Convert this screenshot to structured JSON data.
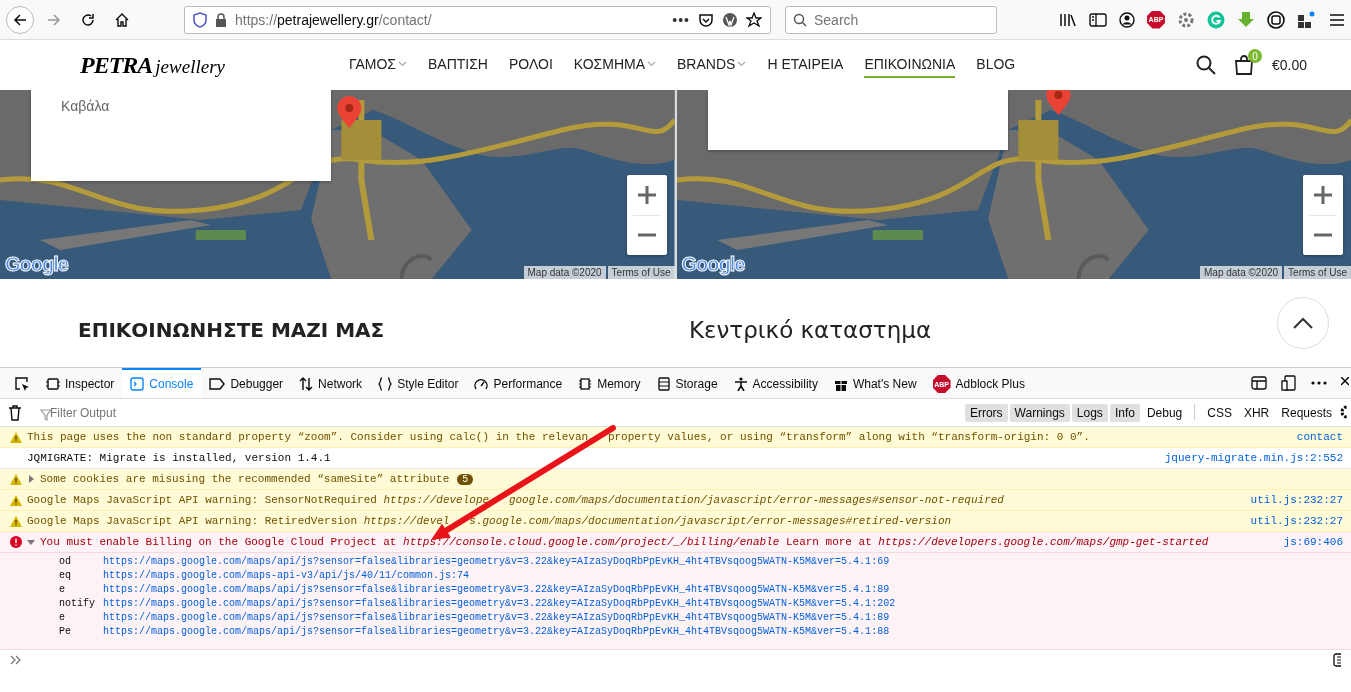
{
  "browser": {
    "url": {
      "scheme": "https://",
      "domain": "petrajewellery.gr",
      "path": "/contact/"
    },
    "page_actions": "•••",
    "search": {
      "placeholder": "Search"
    },
    "abp_label": "ABP"
  },
  "site": {
    "logo": {
      "main": "PETRA",
      "sub": "jewellery"
    },
    "nav": [
      {
        "label": "ΓΑΜΟΣ",
        "dropdown": true,
        "selected": false
      },
      {
        "label": "ΒΑΠΤΙΣΗ",
        "dropdown": false,
        "selected": false
      },
      {
        "label": "ΡΟΛΟΙ",
        "dropdown": false,
        "selected": false
      },
      {
        "label": "ΚΟΣΜΗΜΑ",
        "dropdown": true,
        "selected": false
      },
      {
        "label": "BRANDS",
        "dropdown": true,
        "selected": false
      },
      {
        "label": "Η ΕΤΑΙΡΕΙΑ",
        "dropdown": false,
        "selected": false
      },
      {
        "label": "ΕΠΙΚΟΙΝΩΝΙΑ",
        "dropdown": false,
        "selected": true
      },
      {
        "label": "BLOG",
        "dropdown": false,
        "selected": false
      }
    ],
    "cart": {
      "count": "0",
      "total": "€0.00"
    }
  },
  "maps": [
    {
      "card_text": "Καβάλα",
      "logo": "Google",
      "attribution": "Map data ©2020",
      "terms": "Terms of Use"
    },
    {
      "logo": "Google",
      "attribution": "Map data ©2020",
      "terms": "Terms of Use"
    }
  ],
  "headings": [
    "ΕΠΙΚΟΙΝΩΝΗΣΤΕ ΜΑΖΙ ΜΑΣ",
    "Κεντρικό καταστημα"
  ],
  "devtools": {
    "tabs": [
      {
        "label": "Inspector",
        "selected": false
      },
      {
        "label": "Console",
        "selected": true
      },
      {
        "label": "Debugger",
        "selected": false
      },
      {
        "label": "Network",
        "selected": false
      },
      {
        "label": "Style Editor",
        "selected": false
      },
      {
        "label": "Performance",
        "selected": false
      },
      {
        "label": "Memory",
        "selected": false
      },
      {
        "label": "Storage",
        "selected": false
      },
      {
        "label": "Accessibility",
        "selected": false
      },
      {
        "label": "What's New",
        "selected": false
      },
      {
        "label": "Adblock Plus",
        "selected": false,
        "icon_label": "ABP"
      }
    ],
    "filter": {
      "placeholder": "Filter Output"
    },
    "levels": [
      {
        "label": "Errors",
        "selected": true
      },
      {
        "label": "Warnings",
        "selected": true
      },
      {
        "label": "Logs",
        "selected": true
      },
      {
        "label": "Info",
        "selected": true
      },
      {
        "label": "Debug",
        "selected": false
      }
    ],
    "types": [
      {
        "label": "CSS",
        "selected": false
      },
      {
        "label": "XHR",
        "selected": false
      },
      {
        "label": "Requests",
        "selected": false
      }
    ],
    "messages": [
      {
        "kind": "warning",
        "text": "This page uses the non standard property “zoom”. Consider using calc() in the relevan",
        "text_after": "property values, or using “transform” along with “transform-origin: 0 0”.",
        "source": "contact"
      },
      {
        "kind": "log",
        "text": "JQMIGRATE: Migrate is installed, version 1.4.1",
        "source": "jquery-migrate.min.js:2:552"
      },
      {
        "kind": "warning",
        "text": "Some cookies are misusing the recommended “sameSite” attribute",
        "expanded": false,
        "count": "5"
      },
      {
        "kind": "warning",
        "text": "Google Maps JavaScript API warning: SensorNotRequired *https://develope*",
        "text_after": "*google.com/maps/documentation/javascript/error-messages#sensor-not-required*",
        "source": "util.js:232:27"
      },
      {
        "kind": "warning",
        "text": "Google Maps JavaScript API warning: RetiredVersion *https://devel*",
        "text_after": "*s.google.com/maps/documentation/javascript/error-messages#retired-version*",
        "source": "util.js:232:27"
      },
      {
        "kind": "error",
        "text": "You must enable Billing on the Google Cloud Project at *https://console.cloud.google.com/project/_/billing/enable* Learn more at *https://developers.google.com/maps/gmp-get-started*",
        "source": "js:69:406",
        "expanded": true,
        "stack": [
          {
            "fn": "od",
            "url": "https://maps.google.com/maps/api/js?sensor=false&libraries=geometry&v=3.22&key=AIzaSyDoqRbPpEvKH_4ht4TBVsqoog5WATN-K5M&ver=5.4.1:69"
          },
          {
            "fn": "eq",
            "url": "https://maps.google.com/maps-api-v3/api/js/40/11/common.js:74"
          },
          {
            "fn": "e",
            "url": "https://maps.google.com/maps/api/js?sensor=false&libraries=geometry&v=3.22&key=AIzaSyDoqRbPpEvKH_4ht4TBVsqoog5WATN-K5M&ver=5.4.1:89"
          },
          {
            "fn": "notify",
            "url": "https://maps.google.com/maps/api/js?sensor=false&libraries=geometry&v=3.22&key=AIzaSyDoqRbPpEvKH_4ht4TBVsqoog5WATN-K5M&ver=5.4.1:202"
          },
          {
            "fn": "e",
            "url": "https://maps.google.com/maps/api/js?sensor=false&libraries=geometry&v=3.22&key=AIzaSyDoqRbPpEvKH_4ht4TBVsqoog5WATN-K5M&ver=5.4.1:89"
          },
          {
            "fn": "Pe",
            "url": "https://maps.google.com/maps/api/js?sensor=false&libraries=geometry&v=3.22&key=AIzaSyDoqRbPpEvKH_4ht4TBVsqoog5WATN-K5M&ver=5.4.1:88"
          }
        ]
      }
    ]
  }
}
